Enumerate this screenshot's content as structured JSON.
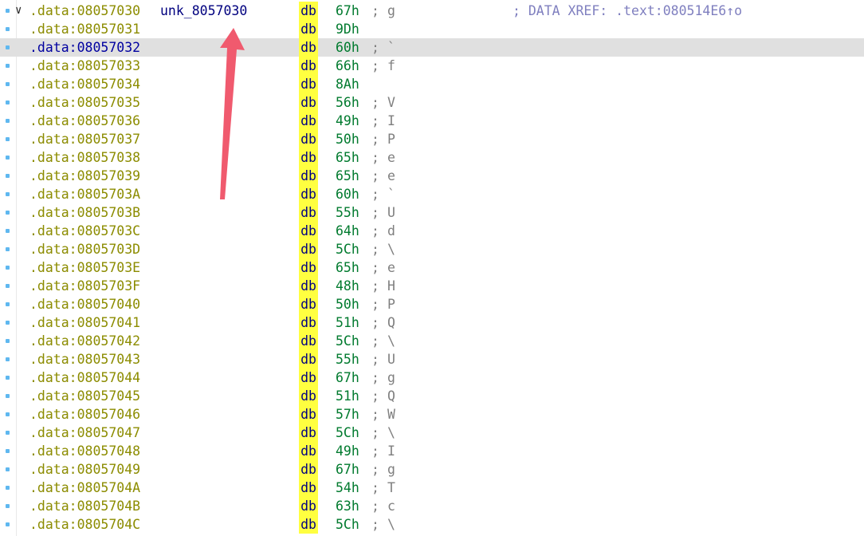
{
  "listing": {
    "selected_index": 2,
    "rows": [
      {
        "addr": ".data:08057030",
        "label": "unk_8057030",
        "mnem": "db",
        "val": "67h",
        "chr": "g",
        "xref": "; DATA XREF: .text:080514E6↑o",
        "fold": "∨"
      },
      {
        "addr": ".data:08057031",
        "mnem": "db",
        "val": "9Dh"
      },
      {
        "addr": ".data:08057032",
        "mnem": "db",
        "val": "60h",
        "chr": "`"
      },
      {
        "addr": ".data:08057033",
        "mnem": "db",
        "val": "66h",
        "chr": "f"
      },
      {
        "addr": ".data:08057034",
        "mnem": "db",
        "val": "8Ah"
      },
      {
        "addr": ".data:08057035",
        "mnem": "db",
        "val": "56h",
        "chr": "V"
      },
      {
        "addr": ".data:08057036",
        "mnem": "db",
        "val": "49h",
        "chr": "I"
      },
      {
        "addr": ".data:08057037",
        "mnem": "db",
        "val": "50h",
        "chr": "P"
      },
      {
        "addr": ".data:08057038",
        "mnem": "db",
        "val": "65h",
        "chr": "e"
      },
      {
        "addr": ".data:08057039",
        "mnem": "db",
        "val": "65h",
        "chr": "e"
      },
      {
        "addr": ".data:0805703A",
        "mnem": "db",
        "val": "60h",
        "chr": "`"
      },
      {
        "addr": ".data:0805703B",
        "mnem": "db",
        "val": "55h",
        "chr": "U"
      },
      {
        "addr": ".data:0805703C",
        "mnem": "db",
        "val": "64h",
        "chr": "d"
      },
      {
        "addr": ".data:0805703D",
        "mnem": "db",
        "val": "5Ch",
        "chr": "\\"
      },
      {
        "addr": ".data:0805703E",
        "mnem": "db",
        "val": "65h",
        "chr": "e"
      },
      {
        "addr": ".data:0805703F",
        "mnem": "db",
        "val": "48h",
        "chr": "H"
      },
      {
        "addr": ".data:08057040",
        "mnem": "db",
        "val": "50h",
        "chr": "P"
      },
      {
        "addr": ".data:08057041",
        "mnem": "db",
        "val": "51h",
        "chr": "Q"
      },
      {
        "addr": ".data:08057042",
        "mnem": "db",
        "val": "5Ch",
        "chr": "\\"
      },
      {
        "addr": ".data:08057043",
        "mnem": "db",
        "val": "55h",
        "chr": "U"
      },
      {
        "addr": ".data:08057044",
        "mnem": "db",
        "val": "67h",
        "chr": "g"
      },
      {
        "addr": ".data:08057045",
        "mnem": "db",
        "val": "51h",
        "chr": "Q"
      },
      {
        "addr": ".data:08057046",
        "mnem": "db",
        "val": "57h",
        "chr": "W"
      },
      {
        "addr": ".data:08057047",
        "mnem": "db",
        "val": "5Ch",
        "chr": "\\"
      },
      {
        "addr": ".data:08057048",
        "mnem": "db",
        "val": "49h",
        "chr": "I"
      },
      {
        "addr": ".data:08057049",
        "mnem": "db",
        "val": "67h",
        "chr": "g"
      },
      {
        "addr": ".data:0805704A",
        "mnem": "db",
        "val": "54h",
        "chr": "T"
      },
      {
        "addr": ".data:0805704B",
        "mnem": "db",
        "val": "63h",
        "chr": "c"
      },
      {
        "addr": ".data:0805704C",
        "mnem": "db",
        "val": "5Ch",
        "chr": "\\"
      }
    ]
  },
  "annotation": {
    "arrow_color": "#f05a6e",
    "icon": "red-arrow-annotation-icon"
  },
  "colors": {
    "address": "#8c8c00",
    "mnemonic_highlight": "#ffff40",
    "value": "#007a2e",
    "comment": "#7f7f7f",
    "xref": "#7f7fbf",
    "selected_row": "#e0e0e0"
  }
}
